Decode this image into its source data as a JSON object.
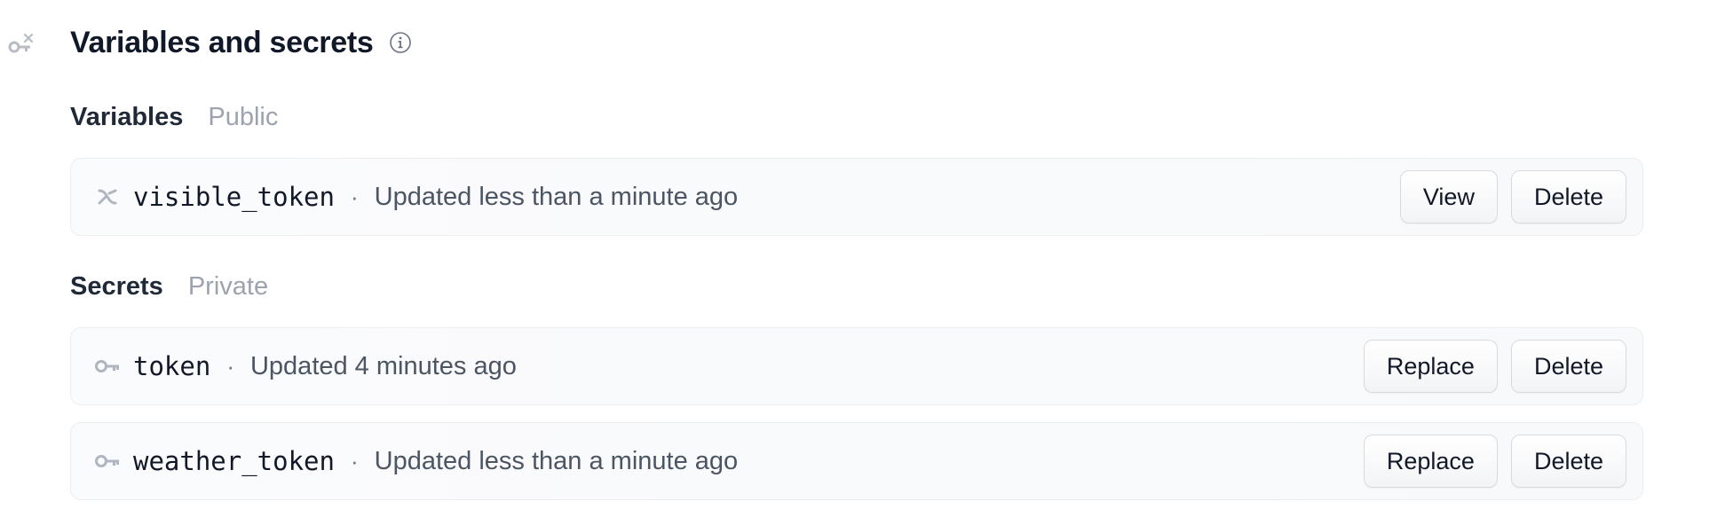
{
  "header": {
    "title": "Variables and secrets",
    "section_icon": "key-variable-icon",
    "info_icon": "info-icon"
  },
  "variables": {
    "title": "Variables",
    "subtitle": "Public",
    "items": [
      {
        "name": "visible_token",
        "separator": "·",
        "updated": "Updated less than a minute ago",
        "icon": "variable-icon",
        "actions": [
          "View",
          "Delete"
        ]
      }
    ]
  },
  "secrets": {
    "title": "Secrets",
    "subtitle": "Private",
    "items": [
      {
        "name": "token",
        "separator": "·",
        "updated": "Updated 4 minutes ago",
        "icon": "key-icon",
        "actions": [
          "Replace",
          "Delete"
        ]
      },
      {
        "name": "weather_token",
        "separator": "·",
        "updated": "Updated less than a minute ago",
        "icon": "key-icon",
        "actions": [
          "Replace",
          "Delete"
        ]
      }
    ]
  },
  "colors": {
    "text": "#111827",
    "muted": "#9ca3af",
    "icon": "#b0b6bf",
    "row_border": "#eceef1",
    "row_bg": "#f9fafb"
  }
}
